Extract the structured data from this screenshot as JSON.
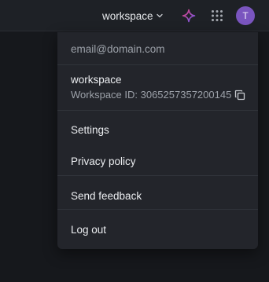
{
  "header": {
    "workspace_label": "workspace",
    "avatar_initial": "T",
    "icons": {
      "workspace_chevron": "chevron-down-icon",
      "ai": "sparkle-icon",
      "apps": "apps-grid-icon"
    },
    "colors": {
      "avatar": "#7a55bf",
      "sparkle_start": "#e0407a",
      "sparkle_end": "#6f5bf0"
    }
  },
  "menu": {
    "email": "email@domain.com",
    "workspace_name": "workspace",
    "workspace_id": "Workspace ID: 3065257357200145",
    "copy_icon": "copy-icon",
    "items": [
      {
        "label": "Settings"
      },
      {
        "label": "Privacy policy"
      },
      {
        "label": "Send feedback"
      },
      {
        "label": "Log out"
      }
    ]
  }
}
